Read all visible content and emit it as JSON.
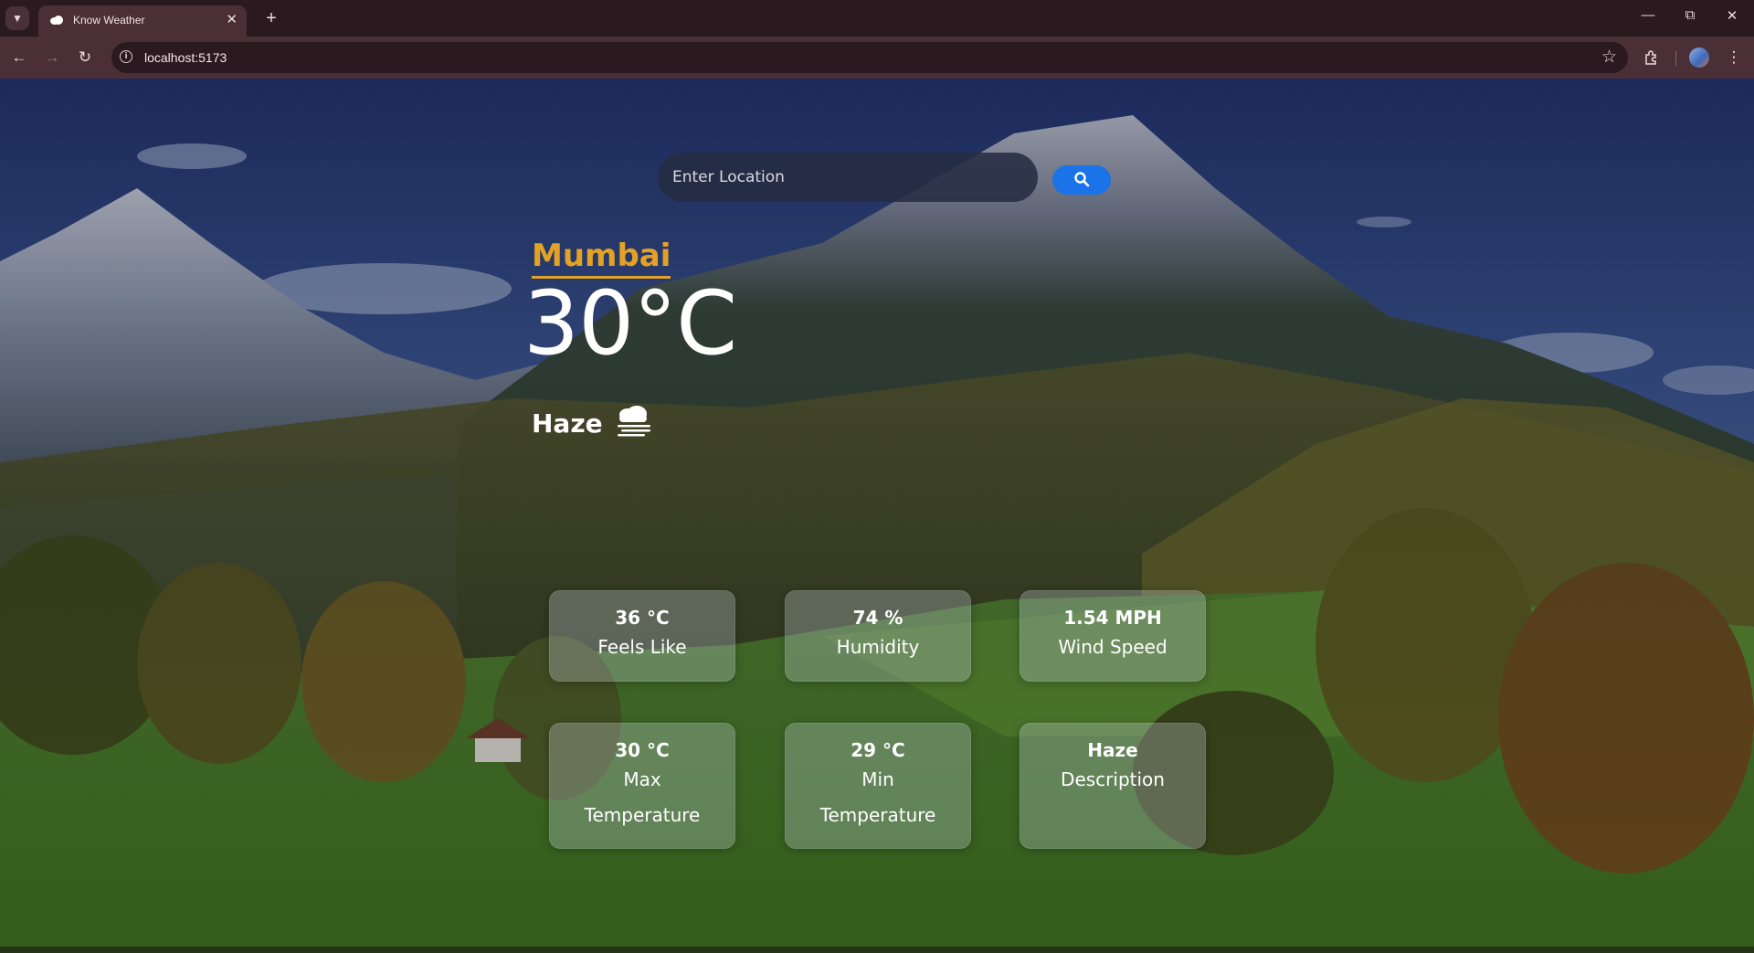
{
  "browser": {
    "tab_title": "Know Weather",
    "url": "localhost:5173"
  },
  "search": {
    "placeholder": "Enter Location",
    "value": ""
  },
  "weather": {
    "city": "Mumbai",
    "temperature": "30°C",
    "condition": "Haze",
    "condition_icon": "haze-cloud-icon"
  },
  "cards": [
    {
      "value": "36 °C",
      "label": "Feels Like"
    },
    {
      "value": "74 %",
      "label": "Humidity"
    },
    {
      "value": "1.54 MPH",
      "label": "Wind Speed"
    },
    {
      "value": "30 °C",
      "label": "Max Temperature"
    },
    {
      "value": "29 °C",
      "label": "Min Temperature"
    },
    {
      "value": "Haze",
      "label": "Description"
    }
  ],
  "colors": {
    "accent_city": "#e3a126",
    "search_button": "#1a73e8"
  }
}
